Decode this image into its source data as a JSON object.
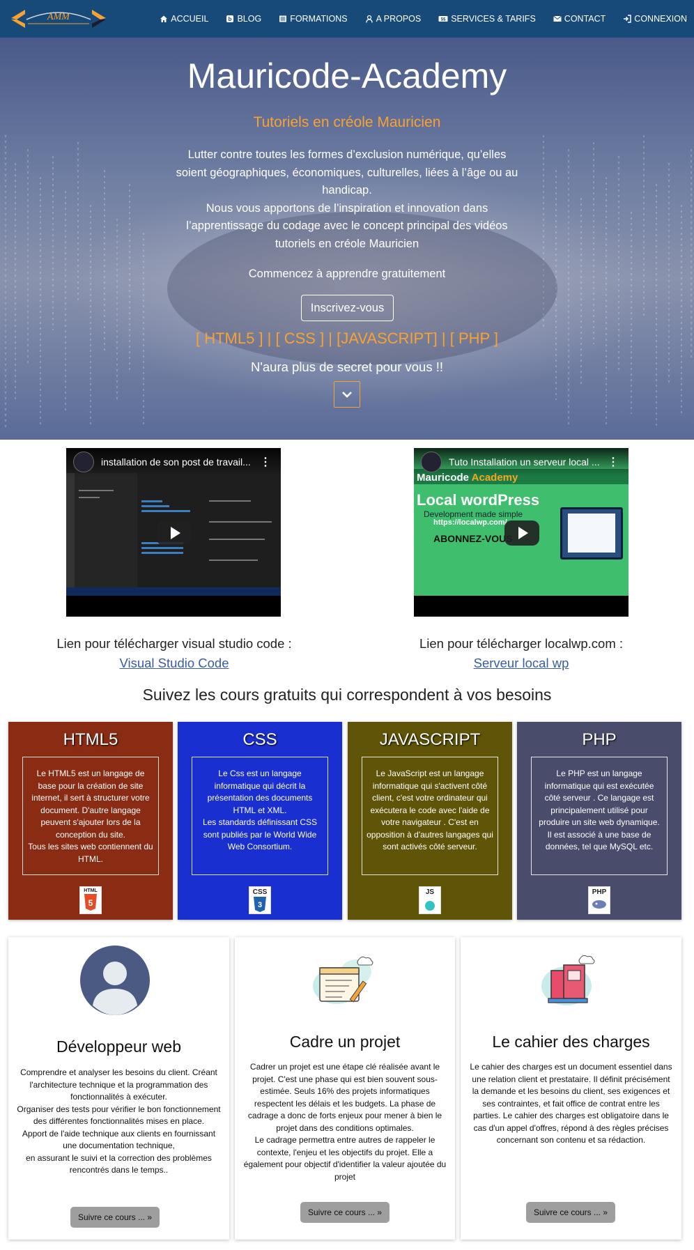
{
  "nav": {
    "items": [
      {
        "label": "ACCUEIL",
        "icon": "home-icon"
      },
      {
        "label": "BLOG",
        "icon": "blog-icon"
      },
      {
        "label": "FORMATIONS",
        "icon": "list-icon"
      },
      {
        "label": "A PROPOS",
        "icon": "user-icon"
      },
      {
        "label": "SERVICES & TARIFS",
        "icon": "price-tag-icon"
      },
      {
        "label": "CONTACT",
        "icon": "envelope-icon"
      },
      {
        "label": "CONNEXION",
        "icon": "sign-in-icon"
      }
    ]
  },
  "hero": {
    "title": "Mauricode-Academy",
    "subtitle": "Tutoriels en créole Mauricien",
    "text_line1": "Lutter contre toutes les formes d’exclusion numérique, qu’elles soient géographiques, économiques, culturelles, liées à l’âge ou au handicap.",
    "text_line2": "Nous vous apportons de l’inspiration et innovation dans l’apprentissage du codage avec le concept principal des vidéos tutoriels en créole Mauricien",
    "cta": "Commencez à apprendre gratuitement",
    "button": "Inscrivez-vous",
    "langs": "[ HTML5 ] | [ CSS ] | [JAVASCRIPT] | [ PHP ]",
    "secret": "N'aura plus de secret pour vous !!"
  },
  "videos": [
    {
      "title": "installation de son post de travail..."
    },
    {
      "title": "Tuto Installation un serveur local ..."
    }
  ],
  "video2_thumb": {
    "brand_first": "Mauricode ",
    "brand_second": "Academy",
    "big": "Local wordPress",
    "small": "Development made simple",
    "url": "https://localwp.com/",
    "abo": "ABONNEZ-VOUS"
  },
  "links": [
    {
      "label": "Lien pour télécharger visual studio code :",
      "link": "Visual Studio Code"
    },
    {
      "label": "Lien pour télécharger localwp.com :",
      "link": "Serveur local wp"
    }
  ],
  "courses_heading": "Suivez les cours gratuits qui correspondent à vos besoins",
  "courses": [
    {
      "title": "HTML5",
      "desc": "Le HTML5 est un langage de base pour la création de site internet, il sert à structurer votre document. D'autre langage peuvent s'ajouter lors de la conception du site.\nTous les sites web contiennent du HTML.",
      "icon_label": "HTML",
      "color": "#8a2b14",
      "icon": "html5-icon"
    },
    {
      "title": "CSS",
      "desc": "Le Css est un langage informatique qui décrit la présentation des documents HTML et XML.\nLes standards définissant CSS sont publiés par le World Wide Web Consortium.",
      "icon_label": "CSS",
      "color": "#1a2fcf",
      "icon": "css3-icon"
    },
    {
      "title": "JAVASCRIPT",
      "desc": "Le JavaScript est un langage informatique qui s'activent côté client, c'est votre ordinateur qui exécutera le code avec l'aide de votre navigateur . C'est en opposition à d'autres langages qui sont activés côté serveur.",
      "icon_label": "JS",
      "color": "#5f5408",
      "icon": "javascript-icon"
    },
    {
      "title": "PHP",
      "desc": "Le PHP est un langage informatique qui est exécutée côté serveur . Ce langage est principalement utilisé pour produire un site web dynamique. Il est associé à une base de données, tel que MySQL etc.",
      "icon_label": "PHP",
      "color": "#494d6b",
      "icon": "php-icon"
    }
  ],
  "cards": [
    {
      "title": "Développeur web",
      "text": "Comprendre et analyser les besoins du client. Créant l'architecture technique et la programmation des fonctionnalités à exécuter.\nOrganiser des tests pour vérifier le bon fonctionnement des différentes fonctionnalités mises en place.\nApport de l'aide technique aux clients en fournissant une documentation technique,\nen assurant le suivi et la correction des problèmes rencontrés dans le temps..",
      "button": "Suivre ce cours ... »",
      "icon": "developer-avatar-icon"
    },
    {
      "title": "Cadre un projet",
      "text": "Cadrer un projet est une étape clé réalisée avant le projet. C'est une phase qui est bien souvent sous-estimée. Seuls 16% des projets informatiques respectent les délais et les budgets. La phase de cadrage a donc de forts enjeux pour mener à bien le projet dans des conditions optimales.\nLe cadrage permettra entre autres de rappeler le contexte, l'enjeu et les objectifs du projet. Elle a également pour objectif d'identifier la valeur ajoutée du projet",
      "button": "Suivre ce cours ... »",
      "icon": "project-document-icon"
    },
    {
      "title": "Le cahier des charges",
      "text": "Le cahier des charges est un document essentiel dans une relation client et prestataire. Il définit précisément la demande et les besoins du client, ses exigences et ses contraintes, et fait office de contrat entre les parties. Le cahier des charges est obligatoire dans le cas d'un appel d'offres, répond à des règles précises concernant son contenu et sa rédaction.",
      "button": "Suivre ce cours ... »",
      "icon": "books-icon"
    }
  ],
  "colors": {
    "nav": "#174a79",
    "accent": "#f7a233",
    "link": "#3b5aa8"
  }
}
